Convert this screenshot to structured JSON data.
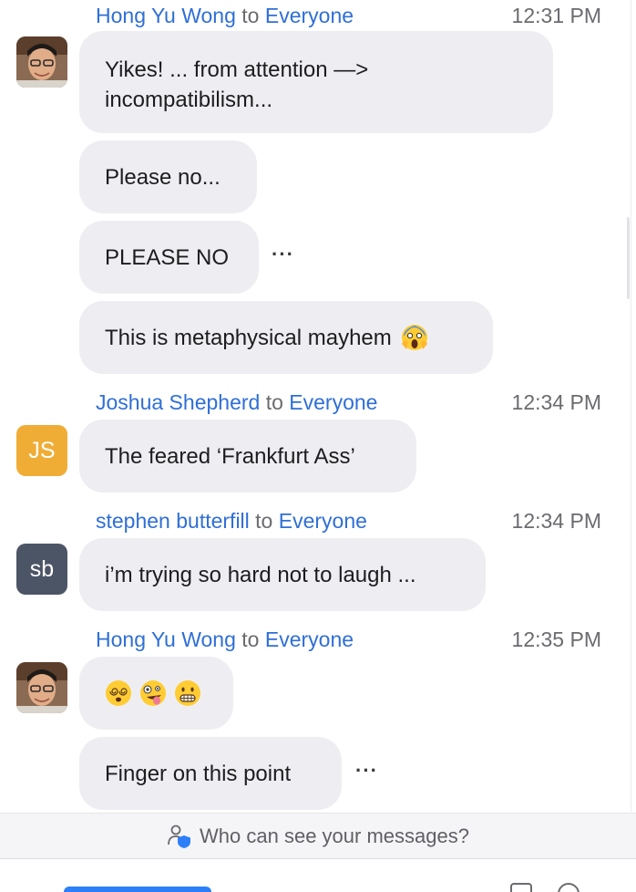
{
  "messages": [
    {
      "sender": "Hong Yu Wong",
      "to_word": "to",
      "recipient": "Everyone",
      "time": "12:31 PM",
      "avatar_type": "photo",
      "bubbles": [
        {
          "lines": [
            "Yikes! ... from attention —>",
            "incompatibilism..."
          ]
        },
        {
          "lines": [
            "Please no..."
          ]
        },
        {
          "lines": [
            "PLEASE NO"
          ],
          "more": "···"
        },
        {
          "lines": [
            "This is metaphysical mayhem"
          ],
          "emoji": [
            "screaming-face"
          ]
        }
      ]
    },
    {
      "sender": "Joshua Shepherd",
      "to_word": "to",
      "recipient": "Everyone",
      "time": "12:34 PM",
      "avatar_type": "initials",
      "avatar_initials": "JS",
      "avatar_color": "#f0ad36",
      "bubbles": [
        {
          "lines": [
            "The feared ‘Frankfurt Ass’"
          ]
        }
      ]
    },
    {
      "sender": "stephen butterfill",
      "to_word": "to",
      "recipient": "Everyone",
      "time": "12:34 PM",
      "avatar_type": "initials",
      "avatar_initials": "sb",
      "avatar_color": "#4c5566",
      "bubbles": [
        {
          "lines": [
            "i’m trying so hard not to laugh ..."
          ]
        }
      ]
    },
    {
      "sender": "Hong Yu Wong",
      "to_word": "to",
      "recipient": "Everyone",
      "time": "12:35 PM",
      "avatar_type": "photo",
      "bubbles": [
        {
          "emoji": [
            "dizzy-face",
            "zany-face",
            "grimacing-face"
          ]
        },
        {
          "lines": [
            "Finger on this point"
          ],
          "more": "···"
        }
      ]
    }
  ],
  "privacy": {
    "text": "Who can see your messages?",
    "icon": "person-shield-icon"
  },
  "colors": {
    "name_blue": "#2f6fd6",
    "bubble_bg": "#eeeef2",
    "muted_text": "#6b6b70"
  }
}
